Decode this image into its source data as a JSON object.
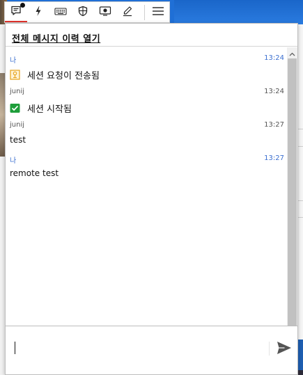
{
  "toolbar": {
    "items": [
      {
        "name": "chat",
        "icon": "chat-icon",
        "active": true,
        "notification": true
      },
      {
        "name": "lightning",
        "icon": "lightning-icon"
      },
      {
        "name": "keyboard",
        "icon": "keyboard-icon"
      },
      {
        "name": "shield",
        "icon": "shield-icon"
      },
      {
        "name": "screen-record",
        "icon": "screen-record-icon"
      },
      {
        "name": "draw",
        "icon": "pen-icon"
      },
      {
        "name": "menu",
        "icon": "hamburger-menu-icon"
      }
    ],
    "active_color": "#e0322b"
  },
  "panel": {
    "history_link": "전체 메시지 이력 열기",
    "messages": [
      {
        "sender": "나",
        "time": "13:24",
        "is_me": true,
        "icon": "session-request-icon",
        "text": "세션 요청이 전송됨"
      },
      {
        "sender": "junij",
        "time": "13:24",
        "is_me": false,
        "icon": "check-icon",
        "text": "세션 시작됨"
      },
      {
        "sender": "junij",
        "time": "13:27",
        "is_me": false,
        "text": "test"
      },
      {
        "sender": "나",
        "time": "13:27",
        "is_me": true,
        "text": "remote test"
      }
    ],
    "input": {
      "value": "",
      "placeholder": ""
    },
    "send_icon": "send-icon"
  },
  "colors": {
    "me_color": "#3b6fd0",
    "other_color": "#555555",
    "check_green": "#1e9e3a",
    "request_orange": "#e5a21a"
  }
}
